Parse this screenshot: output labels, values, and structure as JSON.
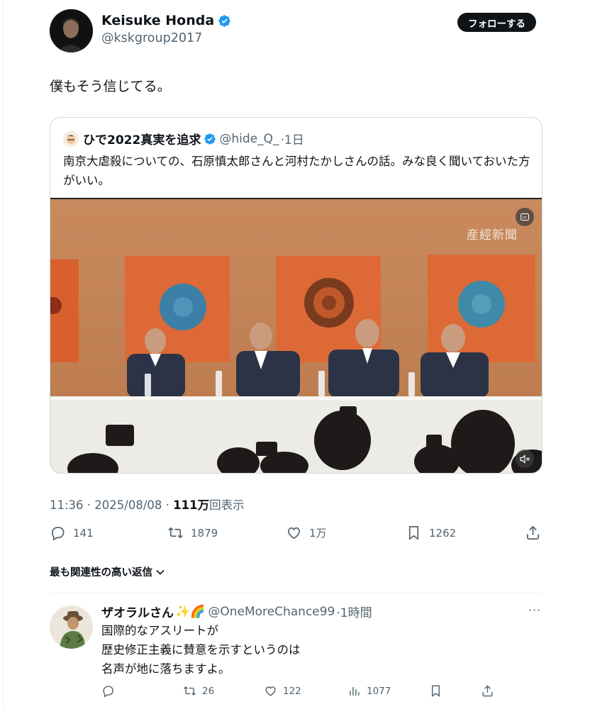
{
  "author": {
    "name": "Keisuke Honda",
    "handle": "@kskgroup2017",
    "follow_label": "フォローする"
  },
  "tweet": {
    "text": "僕もそう信じてる。",
    "time": "11:36 · 2025/08/08 · ",
    "views_count": "111万",
    "views_label": "回表示"
  },
  "quote": {
    "name": "ひで2022真実を追求",
    "handle": "@hide_Q_",
    "age": "·1日",
    "text": "南京大虐殺についての、石原慎太郎さんと河村たかしさんの話。みな良く聞いておいた方がいい。",
    "watermark": "産經新聞",
    "cc_label": "cc"
  },
  "actions": {
    "replies": "141",
    "retweets": "1879",
    "likes": "1万",
    "bookmarks": "1262"
  },
  "sort": {
    "label": "最も関連性の高い返信"
  },
  "reply": {
    "name": "ザオラルさん",
    "name_emoji": "✨🌈",
    "handle": "@OneMoreChance99",
    "age": "·1時間",
    "lines": [
      "国際的なアスリートが",
      "歴史修正主義に賛意を示すというのは",
      "名声が地に落ちますよ。"
    ],
    "replies": "",
    "retweets": "26",
    "likes": "122",
    "views": "1077"
  },
  "colors": {
    "text": "#0f1419",
    "secondary": "#536471",
    "verified": "#1d9bf0",
    "border": "#cfd9de"
  }
}
